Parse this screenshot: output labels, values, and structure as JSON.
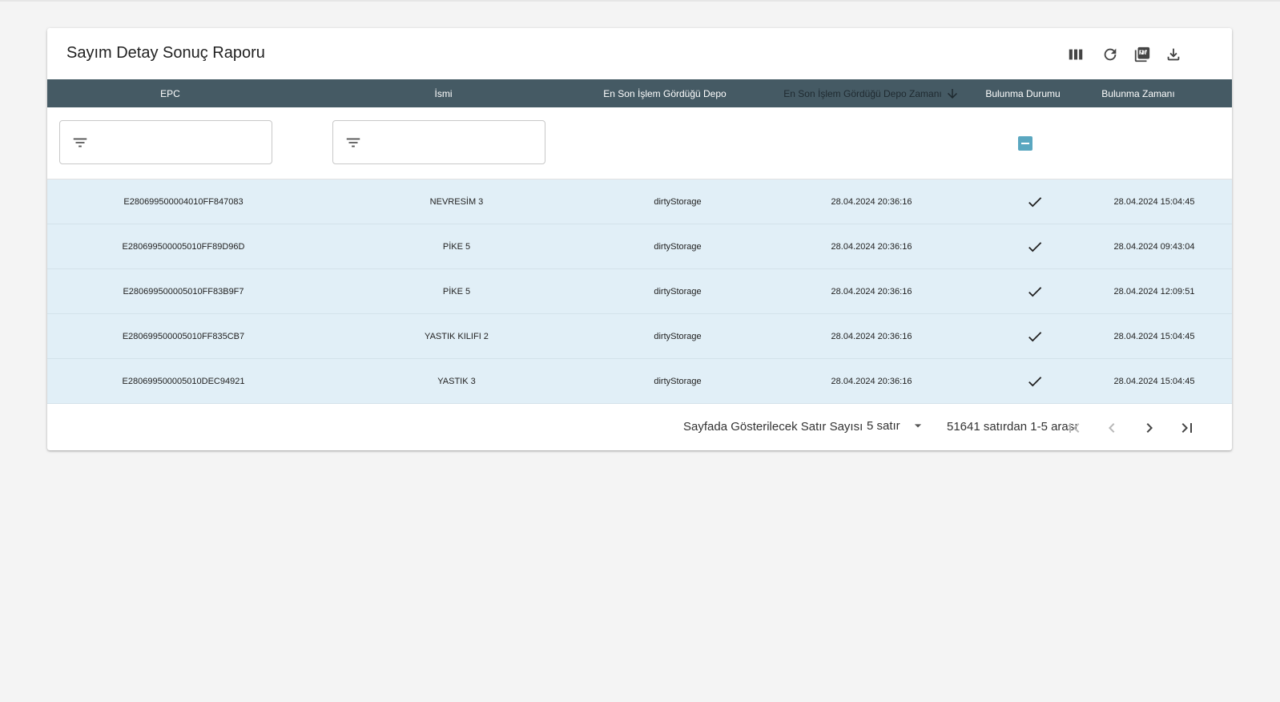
{
  "report": {
    "title": "Sayım Detay Sonuç Raporu"
  },
  "toolbar": {
    "icons": [
      "columns-icon",
      "refresh-icon",
      "pdf-icon",
      "download-icon"
    ]
  },
  "columns": [
    "EPC",
    "İsmi",
    "En Son İşlem Gördüğü Depo",
    "En Son İşlem Gördüğü Depo Zamanı",
    "Bulunma Durumu",
    "Bulunma Zamanı"
  ],
  "sort": {
    "column": "En Son İşlem Gördüğü Depo Zamanı",
    "direction": "descending"
  },
  "filters": {
    "epc": {
      "value": "",
      "placeholder": ""
    },
    "name": {
      "value": "",
      "placeholder": ""
    },
    "found_status": "indeterminate"
  },
  "rows": [
    {
      "epc": "E280699500004010FF847083",
      "name": "NEVRESİM 3",
      "depot": "dirtyStorage",
      "depot_time": "28.04.2024 20:36:16",
      "found": true,
      "found_time": "28.04.2024 15:04:45"
    },
    {
      "epc": "E280699500005010FF89D96D",
      "name": "PİKE 5",
      "depot": "dirtyStorage",
      "depot_time": "28.04.2024 20:36:16",
      "found": true,
      "found_time": "28.04.2024 09:43:04"
    },
    {
      "epc": "E280699500005010FF83B9F7",
      "name": "PİKE 5",
      "depot": "dirtyStorage",
      "depot_time": "28.04.2024 20:36:16",
      "found": true,
      "found_time": "28.04.2024 12:09:51"
    },
    {
      "epc": "E280699500005010FF835CB7",
      "name": "YASTIK KILIFI 2",
      "depot": "dirtyStorage",
      "depot_time": "28.04.2024 20:36:16",
      "found": true,
      "found_time": "28.04.2024 15:04:45"
    },
    {
      "epc": "E280699500005010DEC94921",
      "name": "YASTIK 3",
      "depot": "dirtyStorage",
      "depot_time": "28.04.2024 20:36:16",
      "found": true,
      "found_time": "28.04.2024 15:04:45"
    }
  ],
  "pagination": {
    "rows_per_page_label": "Sayfada Gösterilecek Satır Sayısı",
    "rows_per_page_value": "5 satır",
    "count_text": "51641 satırdan 1-5 arası"
  },
  "colors": {
    "header_bg": "#455a64",
    "row_bg": "#e1eff7",
    "checkbox_accent": "#5aa7c0"
  }
}
